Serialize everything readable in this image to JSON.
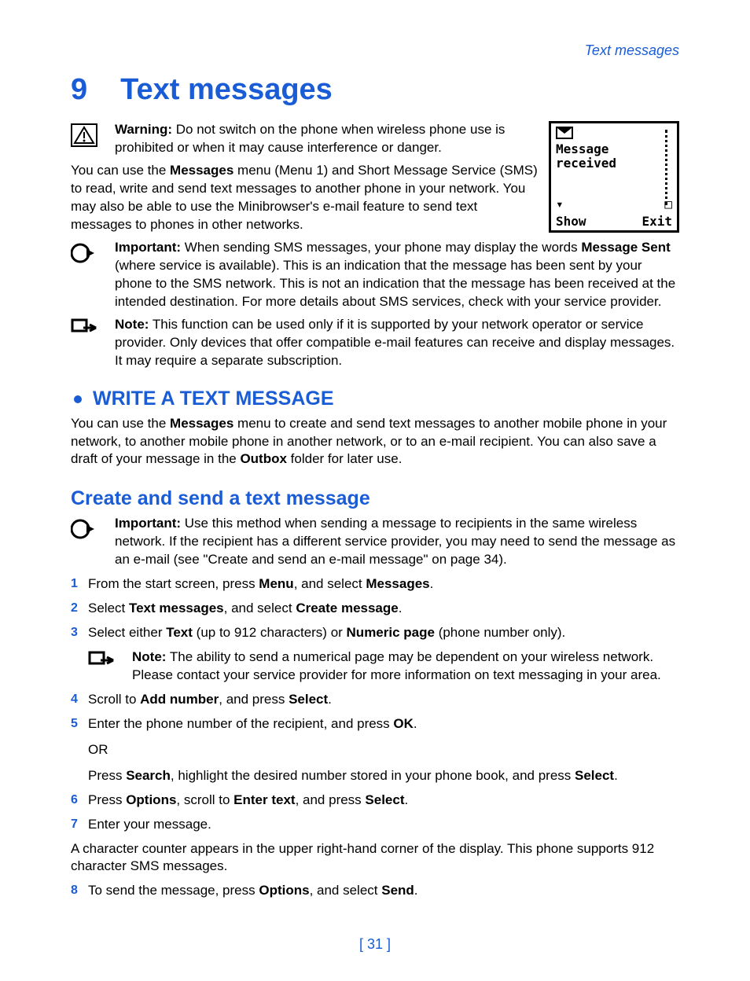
{
  "header_running": "Text messages",
  "chapter_number": "9",
  "chapter_title": "Text messages",
  "warning_label": "Warning:",
  "warning_text": " Do not switch on the phone when wireless phone use is prohibited or when it may cause interference or danger.",
  "intro_1a": "You can use the ",
  "intro_1b": "Messages",
  "intro_1c": " menu (Menu 1) and Short Message Service (SMS) to read, write and send text messages to another phone in your network. You may also be able to use the Minibrowser's e-mail feature to send text messages to phones in other networks.",
  "important_label": "Important:",
  "important1_a": " When sending SMS messages, your phone may display the words ",
  "important1_b": "Message Sent",
  "important1_c": " (where service is available). This is an indication that the message has been sent by your phone to the SMS network. This is not an indication that the message has been received at the intended destination. For more details about SMS services, check with your service provider.",
  "note_label": "Note:",
  "note1_text": " This function can be used only if it is supported by your network operator or service provider. Only devices that offer compatible e-mail features can receive and display messages. It may require a separate subscription.",
  "write_h": "WRITE A TEXT MESSAGE",
  "write_p_a": "You can use the ",
  "write_p_b": "Messages",
  "write_p_c": " menu to create and send text messages to another mobile phone in your network, to another mobile phone in another network, or to an e-mail recipient. You can also save a draft of your message in the ",
  "write_p_d": "Outbox",
  "write_p_e": " folder for later use.",
  "create_h": "Create and send a text message",
  "important2_text": " Use this method when sending a message to recipients in the same wireless network. If the recipient has a different service provider, you may need to send the message as an e-mail (see \"Create and send an e-mail message\" on page 34).",
  "steps": {
    "1": {
      "a": "From the start screen, press ",
      "b": "Menu",
      "c": ", and select ",
      "d": "Messages",
      "e": "."
    },
    "2": {
      "a": "Select ",
      "b": "Text messages",
      "c": ", and select ",
      "d": "Create message",
      "e": "."
    },
    "3": {
      "a": "Select either ",
      "b": "Text",
      "c": " (up to 912 characters) or ",
      "d": "Numeric page",
      "e": " (phone number only)."
    },
    "4": {
      "a": "Scroll to ",
      "b": "Add number",
      "c": ", and press ",
      "d": "Select",
      "e": "."
    },
    "5": {
      "a": "Enter the phone number of the recipient, and press ",
      "b": "OK",
      "c": "."
    },
    "5_or": "OR",
    "5_alt": {
      "a": "Press ",
      "b": "Search",
      "c": ", highlight the desired number stored in your phone book, and press ",
      "d": "Select",
      "e": "."
    },
    "6": {
      "a": "Press ",
      "b": "Options",
      "c": ", scroll to ",
      "d": "Enter text",
      "e": ", and press ",
      "f": "Select",
      "g": "."
    },
    "7": {
      "a": "Enter your message."
    },
    "8": {
      "a": "To send the message, press ",
      "b": "Options",
      "c": ", and select ",
      "d": "Send",
      "e": "."
    }
  },
  "note2_text": " The ability to send a numerical page may be dependent on your wireless network. Please contact your service provider for more information on text messaging in your area.",
  "counter_p": "A character counter appears in the upper right-hand corner of the display. This phone supports 912 character SMS messages.",
  "phone": {
    "line1": "Message",
    "line2": "received",
    "soft_left": "Show",
    "soft_right": "Exit"
  },
  "page_number": "[ 31 ]"
}
